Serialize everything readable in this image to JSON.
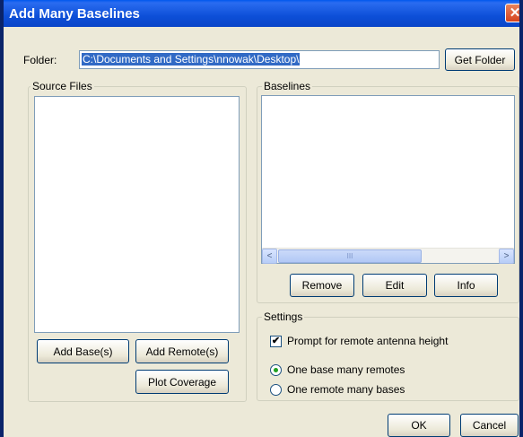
{
  "window": {
    "title": "Add Many Baselines",
    "close_label": "✕"
  },
  "folder": {
    "label": "Folder:",
    "value": "C:\\Documents and Settings\\nnowak\\Desktop\\",
    "get_folder_label": "Get Folder"
  },
  "source_files": {
    "legend": "Source Files",
    "add_base_label": "Add Base(s)",
    "add_remote_label": "Add Remote(s)",
    "plot_coverage_label": "Plot Coverage"
  },
  "baselines": {
    "legend": "Baselines",
    "remove_label": "Remove",
    "edit_label": "Edit",
    "info_label": "Info",
    "scroll_left": "<",
    "scroll_right": ">",
    "scroll_thumb": "III"
  },
  "settings": {
    "legend": "Settings",
    "prompt_label": "Prompt for remote antenna height",
    "prompt_checked": true,
    "checkmark": "✔",
    "radio_options": [
      "One base many remotes",
      "One remote many bases"
    ],
    "selected_option": "One base many remotes"
  },
  "footer": {
    "ok_label": "OK",
    "cancel_label": "Cancel"
  }
}
